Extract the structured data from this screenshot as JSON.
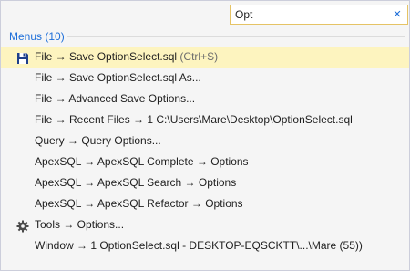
{
  "search": {
    "value": "Opt",
    "clear_glyph": "×"
  },
  "group": {
    "header": "Menus (10)"
  },
  "items": [
    {
      "label": "File → Save OptionSelect.sql",
      "shortcut": "(Ctrl+S)",
      "icon": "save-icon",
      "selected": true
    },
    {
      "label": "File → Save OptionSelect.sql As...",
      "shortcut": ""
    },
    {
      "label": "File → Advanced Save Options...",
      "shortcut": ""
    },
    {
      "label": "File → Recent Files → 1 C:\\Users\\Mare\\Desktop\\OptionSelect.sql",
      "shortcut": ""
    },
    {
      "label": "Query → Query Options...",
      "shortcut": ""
    },
    {
      "label": "ApexSQL → ApexSQL Complete → Options",
      "shortcut": ""
    },
    {
      "label": "ApexSQL → ApexSQL Search → Options",
      "shortcut": ""
    },
    {
      "label": "ApexSQL → ApexSQL Refactor → Options",
      "shortcut": ""
    },
    {
      "label": "Tools → Options...",
      "shortcut": "",
      "icon": "gear-icon"
    },
    {
      "label": "Window → 1 OptionSelect.sql - DESKTOP-EQSCKTT\\...\\Mare (55))",
      "shortcut": ""
    }
  ],
  "colors": {
    "accent": "#1e6fd9",
    "selection": "#fdf4bf",
    "search_border": "#e5c365"
  }
}
